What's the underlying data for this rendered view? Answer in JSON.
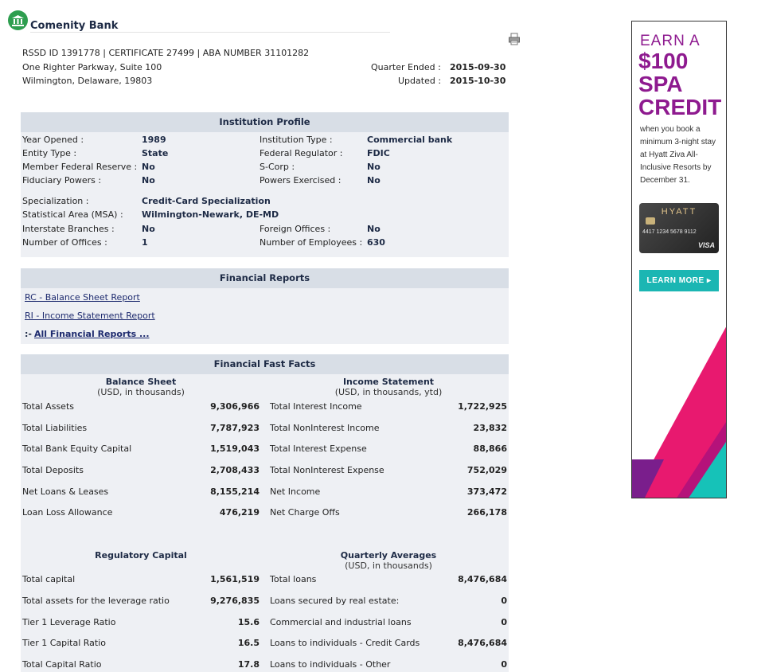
{
  "bank": {
    "name": "Comenity Bank",
    "ids": "RSSD ID 1391778 | CERTIFICATE 27499 | ABA NUMBER 31101282",
    "address_line1": "One Righter Parkway, Suite 100",
    "address_line2": "Wilmington, Delaware, 19803",
    "quarter_label": "Quarter Ended :",
    "quarter_value": "2015-09-30",
    "updated_label": "Updated :",
    "updated_value": "2015-10-30"
  },
  "profile": {
    "title": "Institution Profile",
    "left": [
      {
        "label": "Year Opened :",
        "value": "1989"
      },
      {
        "label": "Entity Type :",
        "value": "State"
      },
      {
        "label": "Member Federal Reserve :",
        "value": "No"
      },
      {
        "label": "Fiduciary Powers :",
        "value": "No"
      },
      {
        "label": "Specialization :",
        "value": "Credit-Card Specialization"
      },
      {
        "label": "Statistical Area (MSA) :",
        "value": "Wilmington-Newark, DE-MD"
      },
      {
        "label": "Interstate Branches :",
        "value": "No"
      },
      {
        "label": "Number of Offices :",
        "value": "1"
      }
    ],
    "right": [
      {
        "label": "Institution Type :",
        "value": "Commercial bank"
      },
      {
        "label": "Federal Regulator :",
        "value": "FDIC"
      },
      {
        "label": "S-Corp :",
        "value": "No"
      },
      {
        "label": "Powers Exercised :",
        "value": "No"
      },
      {
        "label": "Foreign Offices :",
        "value": "No"
      },
      {
        "label": "Number of Employees :",
        "value": "630"
      }
    ]
  },
  "reports": {
    "title": "Financial Reports",
    "links": [
      "RC - Balance Sheet Report",
      "RI - Income Statement Report"
    ],
    "all_prefix": ":-",
    "all_link": "All Financial Reports ..."
  },
  "facts": {
    "title": "Financial Fast Facts",
    "balance_head": "Balance Sheet",
    "balance_unit": "(USD, in thousands)",
    "income_head": "Income Statement",
    "income_unit": "(USD, in thousands, ytd)",
    "balance": [
      {
        "label": "Total Assets",
        "value": "9,306,966"
      },
      {
        "label": "Total Liabilities",
        "value": "7,787,923"
      },
      {
        "label": "Total Bank Equity Capital",
        "value": "1,519,043"
      },
      {
        "label": "Total Deposits",
        "value": "2,708,433"
      },
      {
        "label": "Net Loans & Leases",
        "value": "8,155,214"
      },
      {
        "label": "Loan Loss Allowance",
        "value": "476,219"
      }
    ],
    "income": [
      {
        "label": "Total Interest Income",
        "value": "1,722,925"
      },
      {
        "label": "Total NonInterest Income",
        "value": "23,832"
      },
      {
        "label": "Total Interest Expense",
        "value": "88,866"
      },
      {
        "label": "Total NonInterest Expense",
        "value": "752,029"
      },
      {
        "label": "Net Income",
        "value": "373,472"
      },
      {
        "label": "Net Charge Offs",
        "value": "266,178"
      }
    ],
    "reg_head": "Regulatory Capital",
    "qa_head": "Quarterly Averages",
    "qa_unit": "(USD, in thousands)",
    "regulatory": [
      {
        "label": "Total capital",
        "value": "1,561,519"
      },
      {
        "label": "Total assets for the leverage ratio",
        "value": "9,276,835"
      },
      {
        "label": "Tier 1 Leverage Ratio",
        "value": "15.6"
      },
      {
        "label": "Tier 1 Capital Ratio",
        "value": "16.5"
      },
      {
        "label": "Total Capital Ratio",
        "value": "17.8"
      }
    ],
    "quarterly": [
      {
        "label": "Total loans",
        "value": "8,476,684"
      },
      {
        "label": "Loans secured by real estate:",
        "value": "0"
      },
      {
        "label": "Commercial and industrial loans",
        "value": "0"
      },
      {
        "label": "Loans to individuals - Credit Cards",
        "value": "8,476,684"
      },
      {
        "label": "Loans to individuals - Other",
        "value": "0"
      }
    ]
  },
  "ad": {
    "earn": "EARN A",
    "line1": "$100",
    "line2": "SPA",
    "line3": "CREDIT",
    "copy": "when you book a minimum 3-night stay at Hyatt Ziva All-Inclusive Resorts by December 31.",
    "card_brand": "HYATT",
    "card_number": "4417 1234 5678 9112",
    "card_network": "VISA",
    "button": "LEARN MORE"
  },
  "colors": {
    "accent": "#1d2a45",
    "ad_purple": "#8e1a8f",
    "ad_teal": "#1bb6b3",
    "ad_pink": "#e8196f"
  }
}
